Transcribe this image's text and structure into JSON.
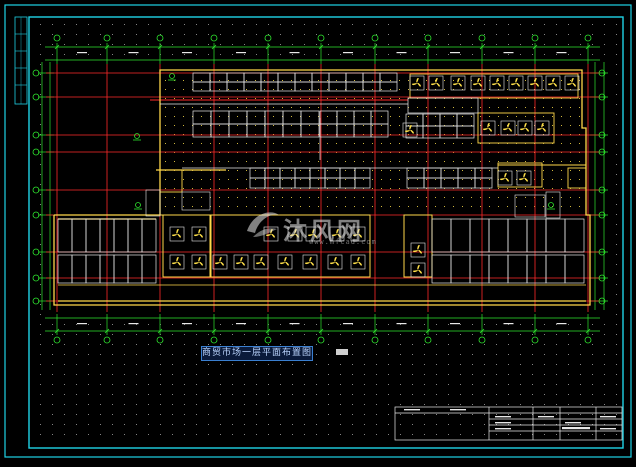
{
  "drawing": {
    "title": "商贸市场一层平面布置图",
    "watermark_main": "沐风网",
    "watermark_sub": "www.mfcad.com",
    "colors": {
      "background": "#000000",
      "frame": "#1fd3e6",
      "axis_grid": "#ff2a2a",
      "dimension": "#2ee62e",
      "walls": "#ffd84a",
      "partitions": "#e8e8e8",
      "fans": "#ffe14a",
      "title_box": "#3a7fd0"
    }
  },
  "title_block": {
    "label": "title-block-table"
  }
}
